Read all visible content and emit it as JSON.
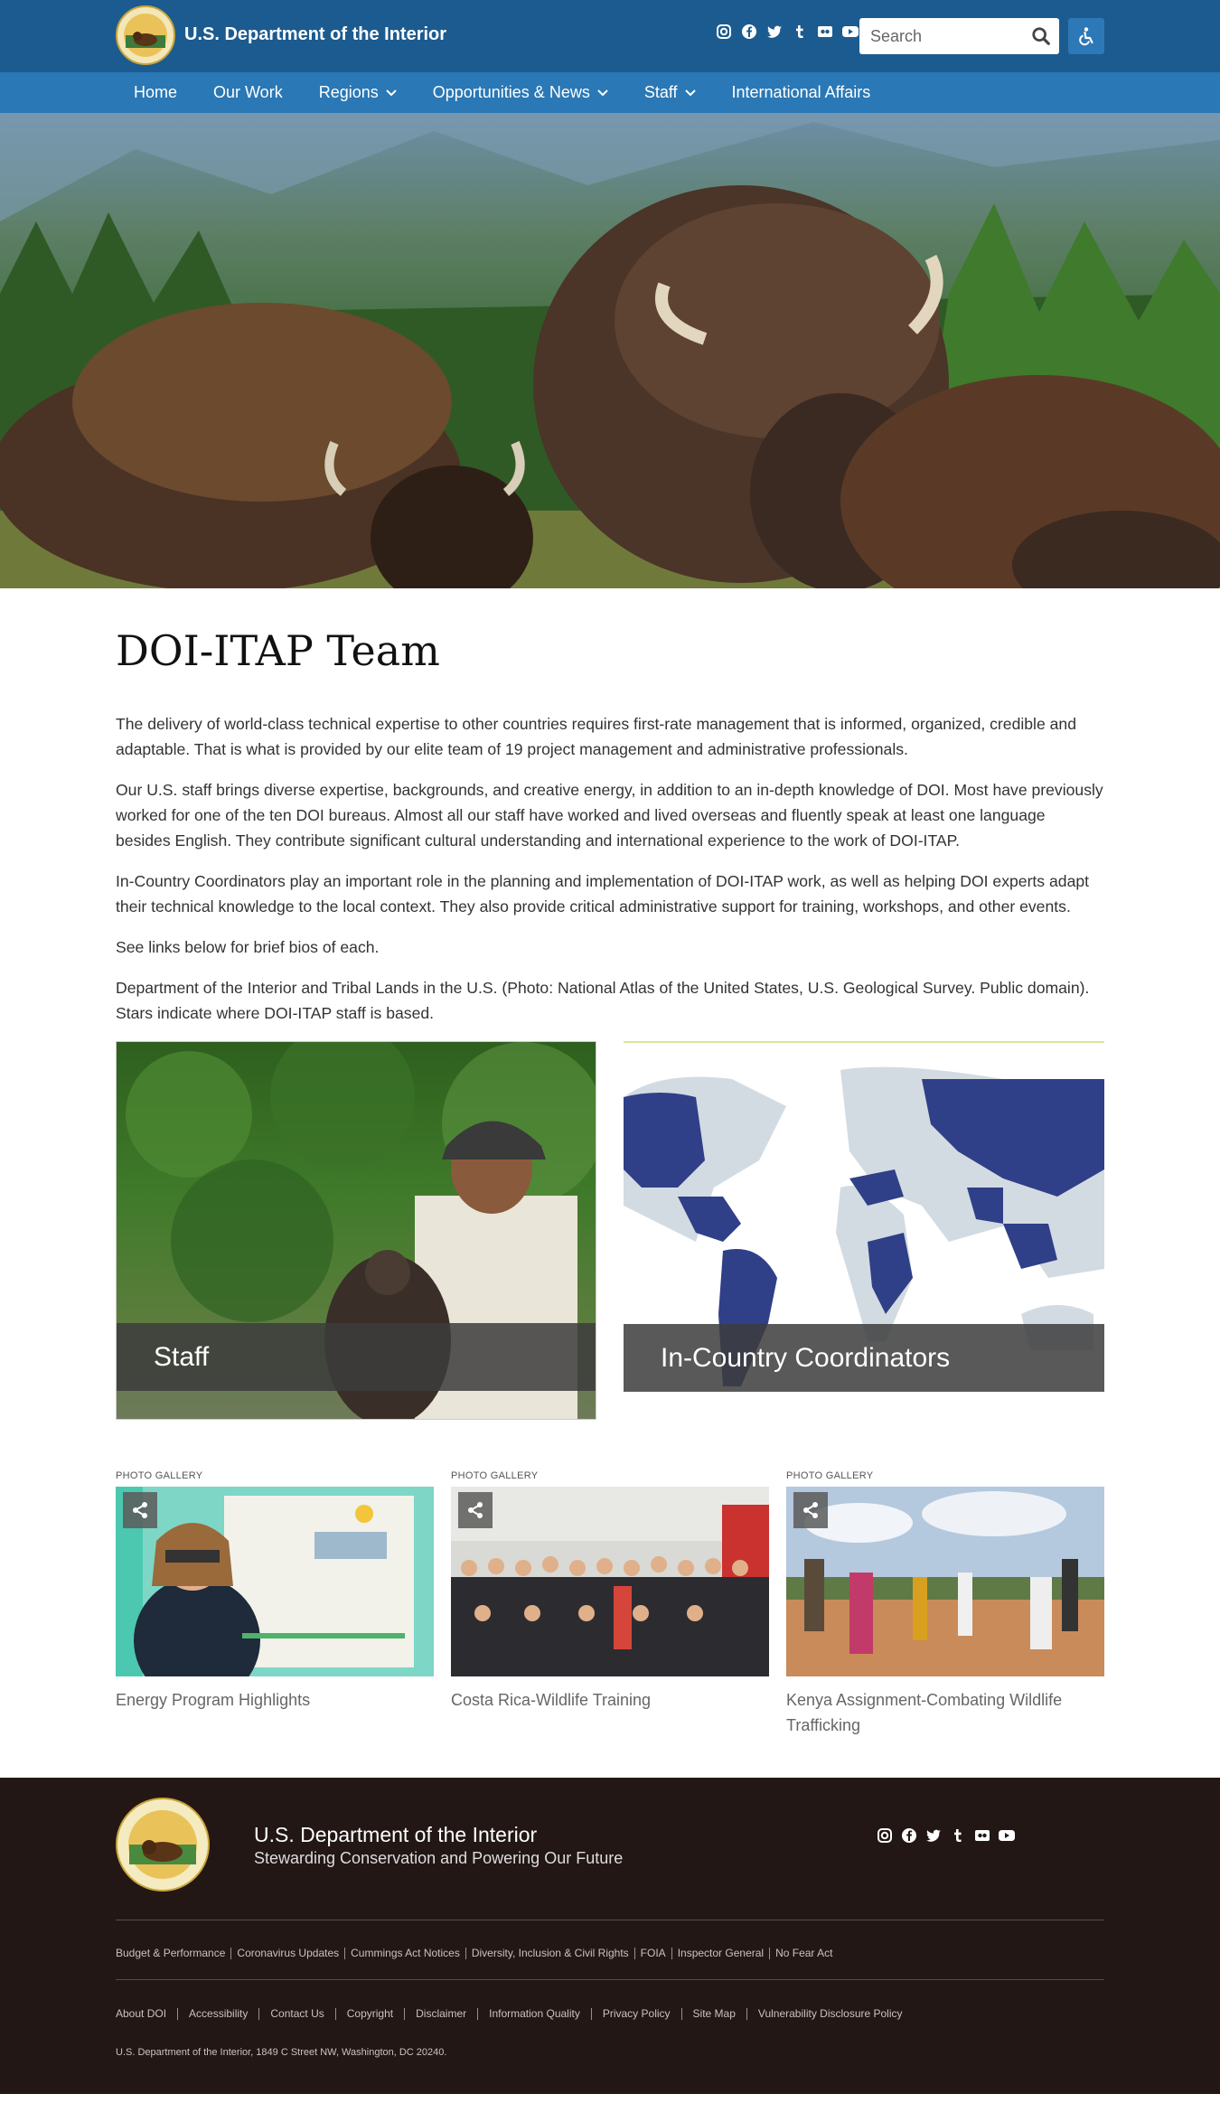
{
  "header": {
    "site_title": "U.S. Department of the Interior",
    "search_placeholder": "Search",
    "social_icons": [
      "instagram-icon",
      "facebook-icon",
      "twitter-icon",
      "tumblr-icon",
      "flickr-icon",
      "youtube-icon"
    ],
    "brand_color": "#1c5b8f",
    "nav_color": "#2a78b5"
  },
  "nav": {
    "items": [
      {
        "label": "Home",
        "has_dropdown": false
      },
      {
        "label": "Our Work",
        "has_dropdown": false
      },
      {
        "label": "Regions",
        "has_dropdown": true
      },
      {
        "label": "Opportunities & News",
        "has_dropdown": true
      },
      {
        "label": "Staff",
        "has_dropdown": true
      },
      {
        "label": "International Affairs",
        "has_dropdown": false
      }
    ]
  },
  "main": {
    "title": "DOI-ITAP Team",
    "paragraphs": [
      "The delivery of world-class technical expertise to other countries requires first-rate management that is informed, organized, credible and adaptable. That is what is provided by our elite team of 19 project management and administrative professionals.",
      "Our U.S. staff brings diverse expertise, backgrounds, and creative energy, in addition to an in-depth knowledge of DOI. Most have previously worked for one of the ten DOI bureaus. Almost all our staff have worked and lived overseas and fluently speak at least one language besides English. They contribute significant cultural understanding and international experience to the work of DOI-ITAP.",
      "In-Country Coordinators play an important role in the planning and implementation of DOI-ITAP work, as well as helping DOI experts adapt their technical knowledge to the local context. They also provide critical administrative support for training, workshops, and other events.",
      "See links below for brief bios of each.",
      "Department of the Interior and Tribal Lands in the U.S. (Photo: National Atlas of the United States, U.S. Geological Survey. Public domain). Stars indicate where DOI-ITAP staff is based."
    ],
    "cards": [
      {
        "label": "Staff"
      },
      {
        "label": "In-Country Coordinators"
      }
    ],
    "galleries": [
      {
        "tag": "PHOTO GALLERY",
        "caption": "Energy Program Highlights"
      },
      {
        "tag": "PHOTO GALLERY",
        "caption": "Costa Rica-Wildlife Training"
      },
      {
        "tag": "PHOTO GALLERY",
        "caption": "Kenya Assignment-Combating Wildlife Trafficking"
      }
    ]
  },
  "footer": {
    "title": "U.S. Department of the Interior",
    "tagline": "Stewarding Conservation and Powering Our Future",
    "links_row1": [
      "Budget & Performance",
      "Coronavirus Updates",
      "Cummings Act Notices",
      "Diversity, Inclusion & Civil Rights",
      "FOIA",
      "Inspector General",
      "No Fear Act"
    ],
    "links_row2": [
      "About DOI",
      "Accessibility",
      "Contact Us",
      "Copyright",
      "Disclaimer",
      "Information Quality",
      "Privacy Policy",
      "Site Map",
      "Vulnerability Disclosure Policy"
    ],
    "address": "U.S. Department of the Interior, 1849 C Street NW, Washington, DC 20240.",
    "background_color": "#221715"
  }
}
